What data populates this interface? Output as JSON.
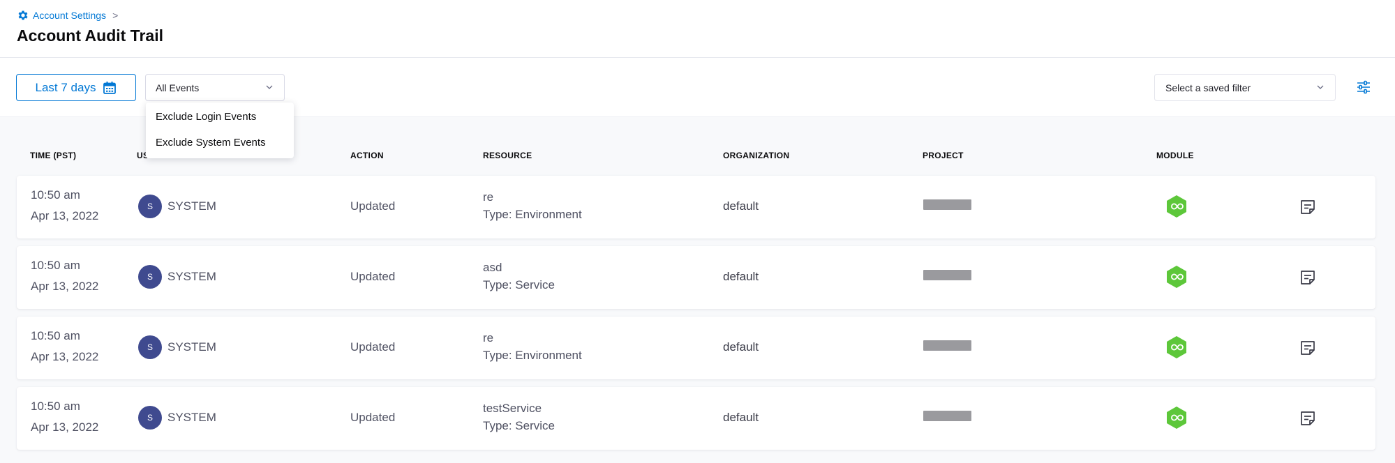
{
  "breadcrumb": {
    "label": "Account Settings",
    "separator": ">"
  },
  "page": {
    "title": "Account Audit Trail"
  },
  "toolbar": {
    "date_range_label": "Last 7 days",
    "events_filter_value": "All Events",
    "events_filter_options": [
      "Exclude Login Events",
      "Exclude System Events"
    ],
    "saved_filter_placeholder": "Select a saved filter"
  },
  "table": {
    "columns": [
      "TIME (PST)",
      "USER",
      "ACTION",
      "RESOURCE",
      "ORGANIZATION",
      "PROJECT",
      "MODULE"
    ],
    "rows": [
      {
        "time": "10:50 am",
        "date": "Apr 13, 2022",
        "avatar_initial": "S",
        "user": "SYSTEM",
        "action": "Updated",
        "resource_name": "re",
        "resource_type": "Type: Environment",
        "organization": "default"
      },
      {
        "time": "10:50 am",
        "date": "Apr 13, 2022",
        "avatar_initial": "S",
        "user": "SYSTEM",
        "action": "Updated",
        "resource_name": "asd",
        "resource_type": "Type: Service",
        "organization": "default"
      },
      {
        "time": "10:50 am",
        "date": "Apr 13, 2022",
        "avatar_initial": "S",
        "user": "SYSTEM",
        "action": "Updated",
        "resource_name": "re",
        "resource_type": "Type: Environment",
        "organization": "default"
      },
      {
        "time": "10:50 am",
        "date": "Apr 13, 2022",
        "avatar_initial": "S",
        "user": "SYSTEM",
        "action": "Updated",
        "resource_name": "testService",
        "resource_type": "Type: Service",
        "organization": "default"
      }
    ]
  },
  "icons": {
    "breadcrumb": "gear-icon",
    "date_range": "calendar-icon",
    "dropdown": "chevron-down-icon",
    "filter": "sliders-icon",
    "module": "cd-module-icon",
    "event_details": "notes-icon"
  },
  "colors": {
    "accent": "#0278d5",
    "avatar": "#3f4a8f",
    "module_green": "#5dc73a",
    "background": "#f8f9fb",
    "redaction": "#9a9a9e"
  }
}
